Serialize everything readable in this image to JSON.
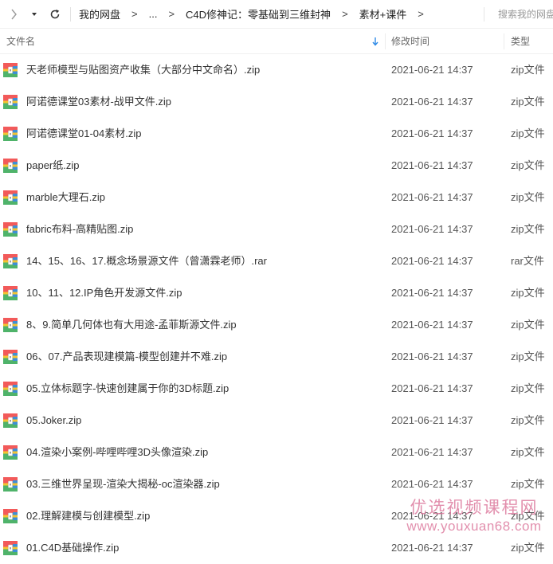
{
  "toolbar": {
    "back_icon": "chevron-left-icon",
    "forward_dropdown_icon": "caret-down-icon",
    "refresh_icon": "refresh-icon"
  },
  "breadcrumb": {
    "items": [
      "我的网盘",
      "...",
      "C4D修神记：零基础到三维封神",
      "素材+课件"
    ],
    "separator": ">"
  },
  "search": {
    "placeholder": "搜索我的网盘"
  },
  "columns": {
    "name": "文件名",
    "modified": "修改时间",
    "type": "类型",
    "sort_icon": "arrow-down-icon"
  },
  "files": [
    {
      "name": "天老师模型与贴图资产收集（大部分中文命名）.zip",
      "modified": "2021-06-21 14:37",
      "type": "zip文件"
    },
    {
      "name": "阿诺德课堂03素材-战甲文件.zip",
      "modified": "2021-06-21 14:37",
      "type": "zip文件"
    },
    {
      "name": "阿诺德课堂01-04素材.zip",
      "modified": "2021-06-21 14:37",
      "type": "zip文件"
    },
    {
      "name": "paper纸.zip",
      "modified": "2021-06-21 14:37",
      "type": "zip文件"
    },
    {
      "name": "marble大理石.zip",
      "modified": "2021-06-21 14:37",
      "type": "zip文件"
    },
    {
      "name": "fabric布料-高精贴图.zip",
      "modified": "2021-06-21 14:37",
      "type": "zip文件"
    },
    {
      "name": "14、15、16、17.概念场景源文件（曾潇霖老师）.rar",
      "modified": "2021-06-21 14:37",
      "type": "rar文件"
    },
    {
      "name": "10、11、12.IP角色开发源文件.zip",
      "modified": "2021-06-21 14:37",
      "type": "zip文件"
    },
    {
      "name": "8、9.简单几何体也有大用途-孟菲斯源文件.zip",
      "modified": "2021-06-21 14:37",
      "type": "zip文件"
    },
    {
      "name": "06、07.产品表现建模篇-模型创建并不难.zip",
      "modified": "2021-06-21 14:37",
      "type": "zip文件"
    },
    {
      "name": "05.立体标题字-快速创建属于你的3D标题.zip",
      "modified": "2021-06-21 14:37",
      "type": "zip文件"
    },
    {
      "name": "05.Joker.zip",
      "modified": "2021-06-21 14:37",
      "type": "zip文件"
    },
    {
      "name": "04.渲染小案例-哔哩哔哩3D头像渲染.zip",
      "modified": "2021-06-21 14:37",
      "type": "zip文件"
    },
    {
      "name": "03.三维世界呈现-渲染大揭秘-oc渲染器.zip",
      "modified": "2021-06-21 14:37",
      "type": "zip文件"
    },
    {
      "name": "02.理解建模与创建模型.zip",
      "modified": "2021-06-21 14:37",
      "type": "zip文件"
    },
    {
      "name": "01.C4D基础操作.zip",
      "modified": "2021-06-21 14:37",
      "type": "zip文件"
    }
  ],
  "file_icon": "archive-file-icon",
  "watermark": {
    "title": "优选视频课程网",
    "url": "www.youxuan68.com"
  },
  "colors": {
    "archive_top": "#f25a5a",
    "archive_bottom": "#4fb36a",
    "archive_right": "#3d8fd6",
    "archive_band": "#f4c530",
    "sort_arrow": "#2e8ae6"
  }
}
